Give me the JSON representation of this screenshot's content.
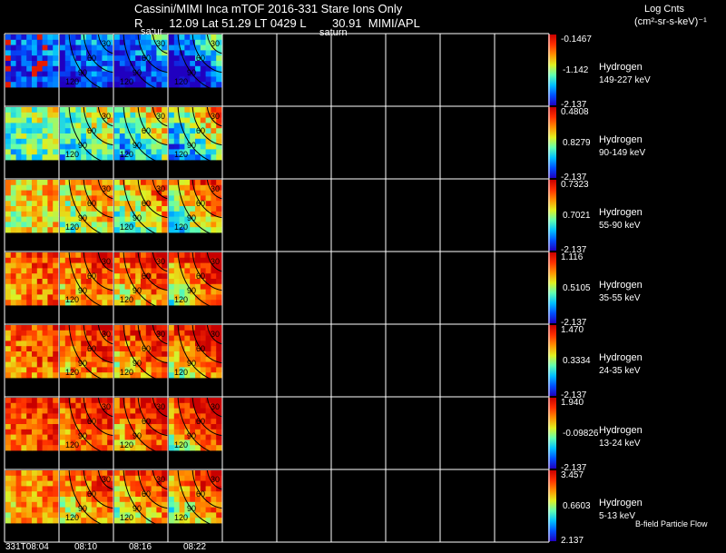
{
  "header": {
    "title": "Cassini/MIMI Inca mTOF  2016-331   Stare   Ions Only",
    "ephemeris": "R        12.09 Lat 51.29 LT 0429 L        30.91  MIMI/APL",
    "planet_left": "satur",
    "planet_right": "saturn",
    "units_line1": "Log Cnts",
    "units_line2": "(cm²-sr-s-keV)⁻¹"
  },
  "footer": {
    "time_labels": [
      "331T08:04",
      "08:10",
      "08:16",
      "08:22"
    ],
    "note": "B-field Particle Flow"
  },
  "colors": {
    "background": "#000000",
    "grid": "#ffffff",
    "colormap": [
      "#2000c0",
      "#0050ff",
      "#00c0ff",
      "#60ffb0",
      "#e0f020",
      "#ff9000",
      "#ff3000",
      "#c80000"
    ]
  },
  "chart_data": {
    "type": "heatmap",
    "title": "Cassini/MIMI Inca mTOF  2016-331   Stare   Ions Only",
    "columns": 10,
    "filled_columns": 4,
    "x_tick_labels": [
      "331T08:04",
      "08:10",
      "08:16",
      "08:22"
    ],
    "contour_labels": [
      "30",
      "60",
      "90",
      "120"
    ],
    "rows": [
      {
        "species": "Hydrogen",
        "energy": "149-227 keV",
        "max": "-0.1467",
        "mid": "-1.142",
        "min": "-2.137",
        "level": 0.15
      },
      {
        "species": "Hydrogen",
        "energy": "90-149 keV",
        "max": "0.4808",
        "mid": "0.8279",
        "min": "-2.137",
        "level": 0.45
      },
      {
        "species": "Hydrogen",
        "energy": "55-90 keV",
        "max": "0.7323",
        "mid": "0.7021",
        "min": "-2.137",
        "level": 0.62
      },
      {
        "species": "Hydrogen",
        "energy": "35-55 keV",
        "max": "1.116",
        "mid": "0.5105",
        "min": "-2.137",
        "level": 0.78
      },
      {
        "species": "Hydrogen",
        "energy": "24-35 keV",
        "max": "1.470",
        "mid": "0.3334",
        "min": "-2.137",
        "level": 0.8
      },
      {
        "species": "Hydrogen",
        "energy": "13-24 keV",
        "max": "1.940",
        "mid": "-0.09826",
        "min": "-2.137",
        "level": 0.83
      },
      {
        "species": "Hydrogen",
        "energy": "5-13 keV",
        "max": "3.457",
        "mid": "0.6603",
        "min": "2.137",
        "level": 0.72
      }
    ]
  }
}
